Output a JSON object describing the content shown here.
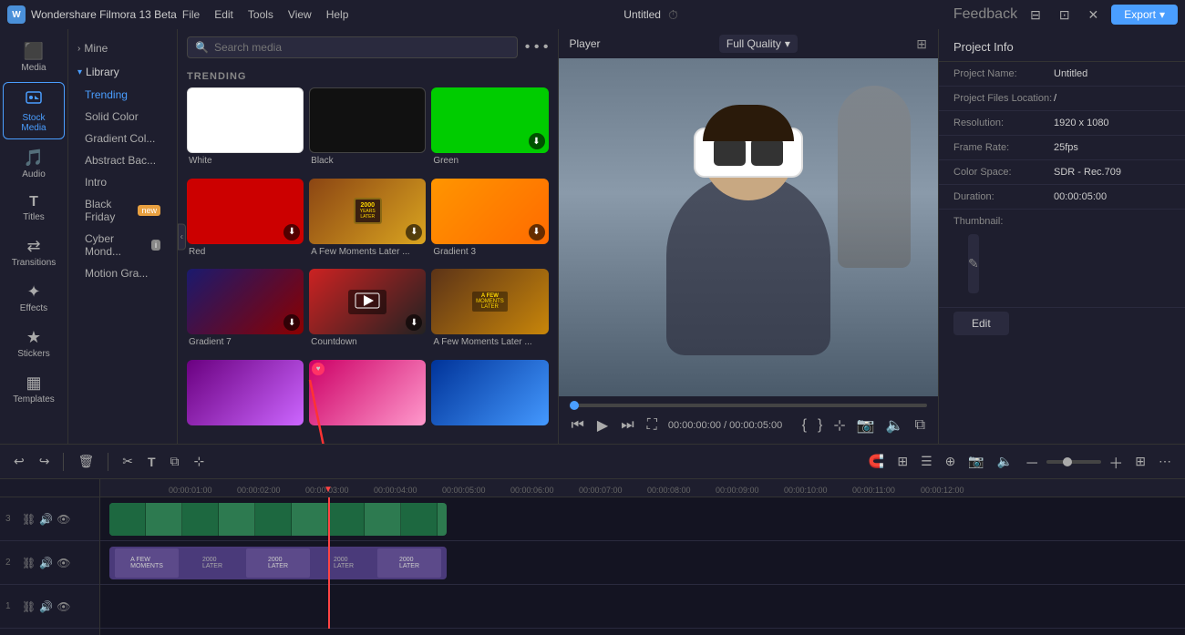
{
  "titlebar": {
    "app_name": "Wondershare Filmora 13 Beta",
    "menu_items": [
      "File",
      "Edit",
      "Tools",
      "View",
      "Help"
    ],
    "project_title": "Untitled",
    "export_label": "Export"
  },
  "toolbar": {
    "items": [
      {
        "id": "media",
        "icon": "⬛",
        "label": "Media",
        "active": false
      },
      {
        "id": "stock-media",
        "icon": "🎬",
        "label": "Stock Media",
        "active": true
      },
      {
        "id": "audio",
        "icon": "🎵",
        "label": "Audio",
        "active": false
      },
      {
        "id": "titles",
        "icon": "T",
        "label": "Titles",
        "active": false
      },
      {
        "id": "transitions",
        "icon": "⇄",
        "label": "Transitions",
        "active": false
      },
      {
        "id": "effects",
        "icon": "✨",
        "label": "Effects",
        "active": false
      },
      {
        "id": "stickers",
        "icon": "★",
        "label": "Stickers",
        "active": false
      },
      {
        "id": "templates",
        "icon": "▦",
        "label": "Templates",
        "active": false
      }
    ]
  },
  "sidebar": {
    "mine_label": "Mine",
    "library_label": "Library",
    "items": [
      {
        "id": "trending",
        "label": "Trending",
        "active": true
      },
      {
        "id": "solid-color",
        "label": "Solid Color",
        "active": false
      },
      {
        "id": "gradient-color",
        "label": "Gradient Col...",
        "active": false
      },
      {
        "id": "abstract-bac",
        "label": "Abstract Bac...",
        "active": false
      },
      {
        "id": "intro",
        "label": "Intro",
        "active": false
      },
      {
        "id": "black-friday",
        "label": "Black Friday",
        "badge": "new",
        "active": false
      },
      {
        "id": "cyber-monday",
        "label": "Cyber Mond...",
        "badge_i": "i",
        "active": false
      },
      {
        "id": "motion-gra",
        "label": "Motion Gra...",
        "active": false
      }
    ]
  },
  "media": {
    "search_placeholder": "Search media",
    "trending_label": "TRENDING",
    "items": [
      {
        "id": "white",
        "label": "White",
        "type": "white",
        "has_download": false
      },
      {
        "id": "black",
        "label": "Black",
        "type": "black",
        "has_download": false
      },
      {
        "id": "green",
        "label": "Green",
        "type": "green",
        "has_download": true
      },
      {
        "id": "red",
        "label": "Red",
        "type": "red",
        "has_download": true
      },
      {
        "id": "moments-later",
        "label": "A Few Moments Later ...",
        "type": "moments",
        "has_download": false
      },
      {
        "id": "gradient3",
        "label": "Gradient 3",
        "type": "gradient3",
        "has_download": true
      },
      {
        "id": "gradient7",
        "label": "Gradient 7",
        "type": "gradient7",
        "has_download": true
      },
      {
        "id": "countdown",
        "label": "Countdown",
        "type": "countdown",
        "has_download": true
      },
      {
        "id": "moments-later2",
        "label": "A Few Moments Later ...",
        "type": "moments2",
        "has_download": false
      },
      {
        "id": "purple",
        "label": "",
        "type": "purple-gradient",
        "has_download": false
      },
      {
        "id": "pink-moments",
        "label": "",
        "type": "pink-moments",
        "has_download": false
      },
      {
        "id": "blue-action",
        "label": "",
        "type": "blue-action",
        "has_download": false
      }
    ]
  },
  "player": {
    "label": "Player",
    "quality": "Full Quality",
    "time_current": "00:00:00:00",
    "time_total": "00:00:05:00"
  },
  "project_info": {
    "title": "Project Info",
    "fields": [
      {
        "label": "Project Name:",
        "value": "Untitled"
      },
      {
        "label": "Project Files Location:",
        "value": "/"
      },
      {
        "label": "Resolution:",
        "value": "1920 x 1080"
      },
      {
        "label": "Frame Rate:",
        "value": "25fps"
      },
      {
        "label": "Color Space:",
        "value": "SDR - Rec.709"
      },
      {
        "label": "Duration:",
        "value": "00:00:05:00"
      },
      {
        "label": "Thumbnail:",
        "value": ""
      }
    ],
    "edit_label": "Edit"
  },
  "timeline": {
    "time_marks": [
      "00:00:01:00",
      "00:00:02:00",
      "00:00:03:00",
      "00:00:04:00",
      "00:00:05:00",
      "00:00:06:00",
      "00:00:07:00",
      "00:00:08:00",
      "00:00:09:00",
      "00:00:10:00",
      "00:00:11:00",
      "00:00:12:00"
    ],
    "tracks": [
      {
        "num": "3",
        "type": "video"
      },
      {
        "num": "2",
        "type": "effect"
      },
      {
        "num": "1",
        "type": "video"
      }
    ]
  },
  "icons": {
    "search": "🔍",
    "more": "•••",
    "undo": "↩",
    "redo": "↪",
    "delete": "🗑",
    "cut": "✂",
    "text": "T",
    "copy": "⧉",
    "play": "▶",
    "rewind": "⏮",
    "fast_forward": "⏭",
    "fullscreen": "⛶",
    "chevron_down": "▾",
    "chevron_right": "›",
    "chevron_left": "‹",
    "eye": "👁",
    "speaker": "🔊",
    "lock": "🔒",
    "magnet": "🧲",
    "scissor": "✂",
    "expand": "⊞",
    "zoom_out": "－",
    "zoom_in": "＋",
    "pencil": "✎",
    "pic": "🖼",
    "camera": "📷",
    "vol": "🔈"
  }
}
